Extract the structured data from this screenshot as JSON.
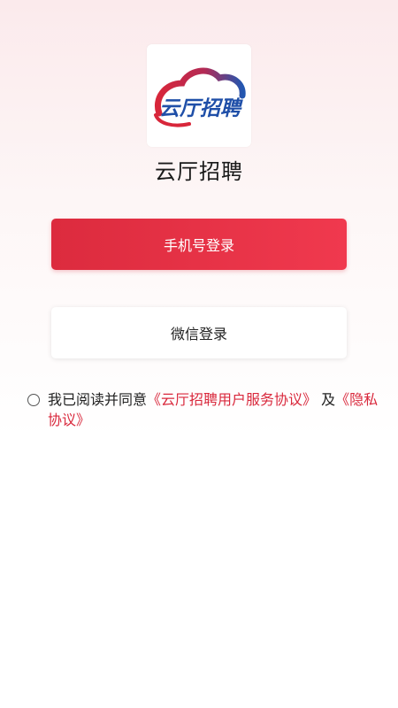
{
  "app": {
    "name": "云厅招聘",
    "logo_text": "云厅招聘"
  },
  "buttons": {
    "phone_login": "手机号登录",
    "wechat_login": "微信登录"
  },
  "agreement": {
    "prefix": "我已阅读并同意",
    "service_link": "《云厅招聘用户服务协议》",
    "and": "及",
    "privacy_link": "《隐私协议》",
    "checked": false
  },
  "colors": {
    "brand_red": "#dc2b3e",
    "brand_blue": "#1f4fa8",
    "link_red": "#d9283c"
  },
  "icons": {
    "logo": "cloud-logo-icon",
    "checkbox": "radio-circle-icon"
  }
}
